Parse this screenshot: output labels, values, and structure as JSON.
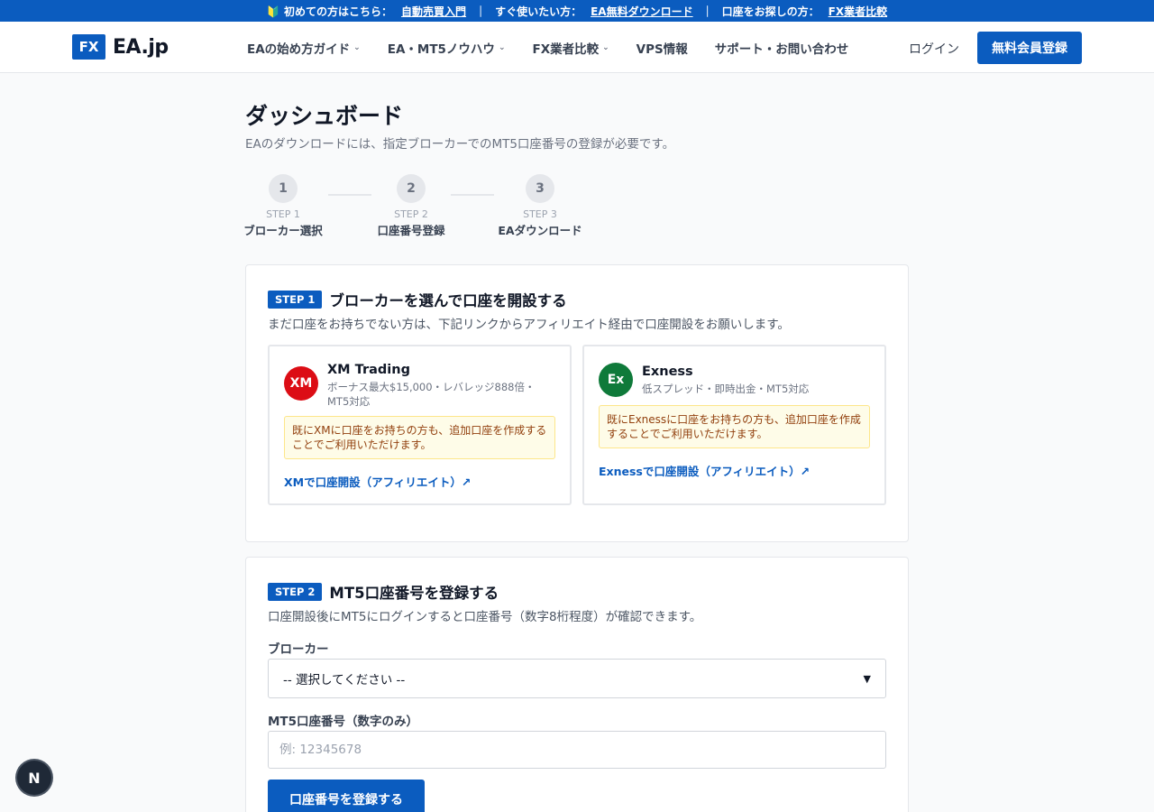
{
  "topbar": {
    "beginner_prefix": "🔰 初めての方はこちら：",
    "beginner_link": "自動売買入門",
    "sep": "｜",
    "quick_prefix": "すぐ使いたい方：",
    "quick_link": "EA無料ダウンロード",
    "account_prefix": "口座をお探しの方：",
    "account_link": "FX業者比較"
  },
  "header": {
    "logo_badge": "FX",
    "logo_text": "EA.jp",
    "nav": [
      {
        "label": "EAの始め方ガイド",
        "dropdown": true
      },
      {
        "label": "EA・MT5ノウハウ",
        "dropdown": true
      },
      {
        "label": "FX業者比較",
        "dropdown": true
      },
      {
        "label": "VPS情報",
        "dropdown": false
      },
      {
        "label": "サポート・お問い合わせ",
        "dropdown": false
      }
    ],
    "login": "ログイン",
    "signup": "無料会員登録"
  },
  "page": {
    "title": "ダッシュボード",
    "subtitle": "EAのダウンロードには、指定ブローカーでのMT5口座番号の登録が必要です。"
  },
  "stepper": [
    {
      "num": "1",
      "small": "STEP 1",
      "name": "ブローカー選択"
    },
    {
      "num": "2",
      "small": "STEP 2",
      "name": "口座番号登録"
    },
    {
      "num": "3",
      "small": "STEP 3",
      "name": "EAダウンロード"
    }
  ],
  "step1": {
    "badge": "STEP 1",
    "title": "ブローカーを選んで口座を開設する",
    "desc": "まだ口座をお持ちでない方は、下記リンクからアフィリエイト経由で口座開設をお願いします。",
    "brokers": [
      {
        "logo": "XM",
        "color": "#dc0d15",
        "name": "XM Trading",
        "meta": "ボーナス最大$15,000・レバレッジ888倍・MT5対応",
        "note": "既にXMに口座をお持ちの方も、追加口座を作成することでご利用いただけます。",
        "link": "XMで口座開設（アフィリエイト）↗"
      },
      {
        "logo": "Ex",
        "color": "#0f7a3a",
        "name": "Exness",
        "meta": "低スプレッド・即時出金・MT5対応",
        "note": "既にExnessに口座をお持ちの方も、追加口座を作成することでご利用いただけます。",
        "link": "Exnessで口座開設（アフィリエイト）↗"
      }
    ]
  },
  "step2": {
    "badge": "STEP 2",
    "title": "MT5口座番号を登録する",
    "desc": "口座開設後にMT5にログインすると口座番号（数字8桁程度）が確認できます。",
    "broker_label": "ブローカー",
    "broker_select": "-- 選択してください --",
    "account_label": "MT5口座番号（数字のみ）",
    "account_placeholder": "例: 12345678",
    "account_value": "",
    "submit": "口座番号を登録する"
  },
  "dev_badge": "N"
}
